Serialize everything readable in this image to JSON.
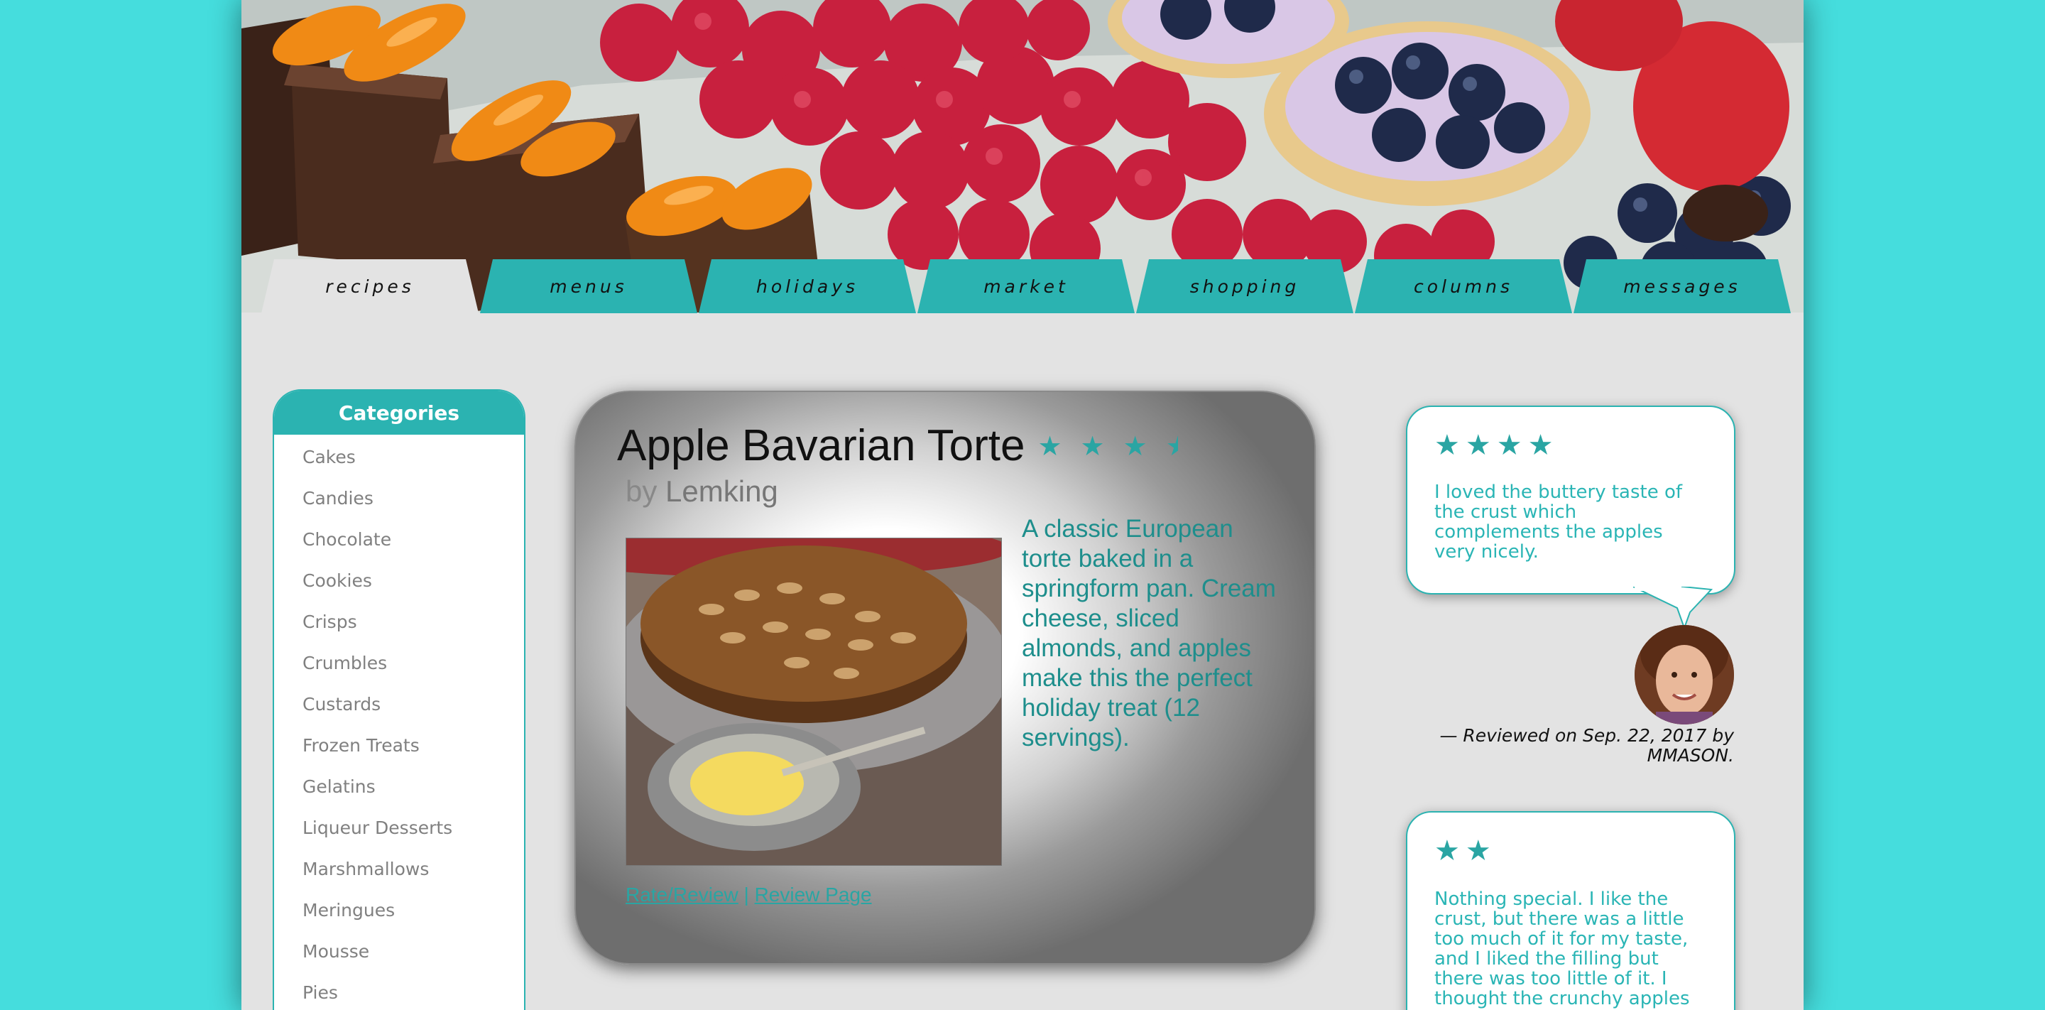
{
  "nav": {
    "tabs": [
      {
        "label": "recipes",
        "active": true
      },
      {
        "label": "menus",
        "active": false
      },
      {
        "label": "holidays",
        "active": false
      },
      {
        "label": "market",
        "active": false
      },
      {
        "label": "shopping",
        "active": false
      },
      {
        "label": "columns",
        "active": false
      },
      {
        "label": "messages",
        "active": false
      }
    ]
  },
  "sidebar": {
    "title": "Categories",
    "items": [
      "Cakes",
      "Candies",
      "Chocolate",
      "Cookies",
      "Crisps",
      "Crumbles",
      "Custards",
      "Frozen Treats",
      "Gelatins",
      "Liqueur Desserts",
      "Marshmallows",
      "Meringues",
      "Mousse",
      "Pies"
    ]
  },
  "recipe": {
    "title": "Apple Bavarian Torte",
    "rating": 3.5,
    "rating_max": 4,
    "byline_prefix": "by",
    "author": "Lemking",
    "description": "A classic European torte baked in a springform pan. Cream cheese, sliced almonds, and apples make this the perfect holiday treat (12 servings).",
    "link_rate": "Rate/Review",
    "link_separator": "|",
    "link_review": "Review Page"
  },
  "reviews": [
    {
      "stars": 4,
      "text": "I loved the buttery taste of the crust which complements the apples very nicely."
    },
    {
      "stars": 2,
      "text": "Nothing special. I like the crust, but there was a little too much of it for my taste, and I liked the filling but there was too little of it. I thought the crunchy apples"
    }
  ],
  "reviewer": {
    "caption": "— Reviewed on Sep. 22, 2017 by MMASON."
  },
  "colors": {
    "page_bg": "#45dddd",
    "accent": "#2bb3b1",
    "review_text": "#2ab5b5",
    "desc_text": "#1e8e8c"
  },
  "icons": {
    "star": "star-icon"
  }
}
